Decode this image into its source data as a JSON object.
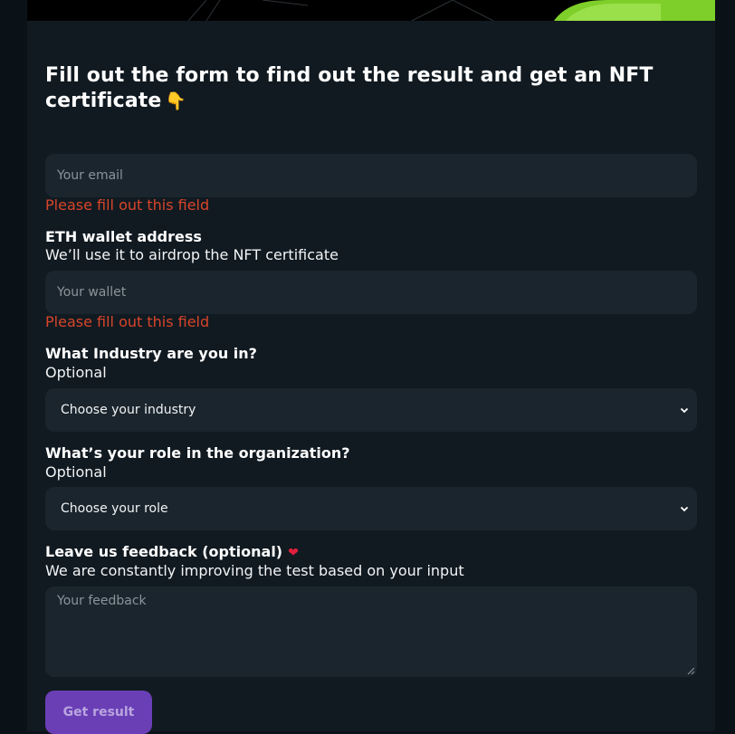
{
  "heading": {
    "text": "Fill out the form to find out the result and get an NFT certificate",
    "emoji": "👇"
  },
  "email": {
    "placeholder": "Your email",
    "value": "",
    "error": "Please fill out this field"
  },
  "wallet": {
    "label": "ETH wallet address",
    "sublabel": "We’ll use it to airdrop the NFT certificate",
    "placeholder": "Your wallet",
    "value": "",
    "error": "Please fill out this field"
  },
  "industry": {
    "label": "What Industry are you in?",
    "sublabel": "Optional",
    "selected": "Choose your industry"
  },
  "role": {
    "label": "What’s your role in the organization?",
    "sublabel": "Optional",
    "selected": "Choose your role"
  },
  "feedback": {
    "label": "Leave us feedback (optional)",
    "sublabel": "We are constantly improving the test based on your input",
    "placeholder": "Your feedback",
    "value": ""
  },
  "submit": {
    "label": "Get result"
  },
  "colors": {
    "background": "#0b1217",
    "panel": "#111a21",
    "input_bg": "#1b252d",
    "error": "#d8452a",
    "button": "#6a3fb6",
    "heart": "#e21f3b"
  },
  "icons": {
    "heading_emoji": "pointing-down-hand-icon",
    "feedback_heart": "heart-icon",
    "select_chevron": "chevron-down-icon"
  }
}
